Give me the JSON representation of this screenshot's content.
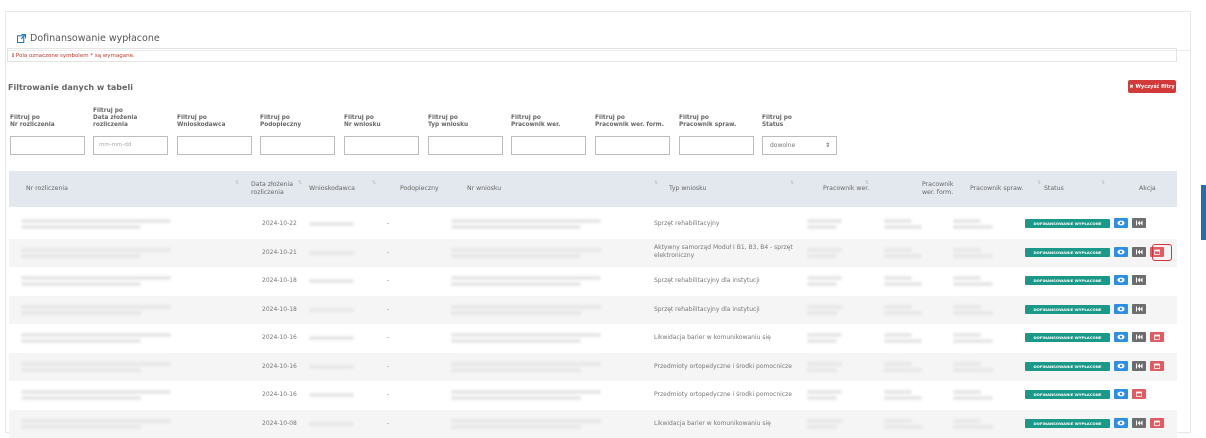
{
  "panel": {
    "title": "Dofinansowanie wypłacone"
  },
  "notice": {
    "text": "ℹ Pola oznaczone symbolem * są wymagane."
  },
  "filters": {
    "title": "Filtrowanie danych w tabeli",
    "clear_label": "Wyczyść filtry",
    "labels": [
      "Filtruj po\nNr rozliczenia",
      "Filtruj po\nData złożenia\nrozliczenia",
      "Filtruj po\nWnioskodawca",
      "Filtruj po\nPodopieczny",
      "Filtruj po\nNr wniosku",
      "Filtruj po\nTyp wniosku",
      "Filtruj po\nPracownik wer.",
      "Filtruj po\nPracownik wer. form.",
      "Filtruj po\nPracownik spraw.",
      "Filtruj po\nStatus"
    ],
    "date_placeholder": "mm-mm-dd",
    "status_value": "dowolne"
  },
  "table": {
    "columns": [
      "Nr rozliczenia",
      "Data złożenia rozliczenia",
      "Wnioskodawca",
      "Podopieczny",
      "Nr wniosku",
      "Typ wniosku",
      "Pracownik wer.",
      "Pracownik wer. form.",
      "Pracownik spraw.",
      "Status",
      "Akcja"
    ],
    "rows": [
      {
        "date": "2024-10-22",
        "podopieczny": "-",
        "typ": "Sprzęt rehabilitacyjny",
        "status": "DOFINANSOWANIE WYPŁACONE",
        "actions": [
          "eye",
          "ff"
        ]
      },
      {
        "date": "2024-10-21",
        "podopieczny": "-",
        "typ": "Aktywny samorząd Moduł I B1, B3, B4 - sprzęt elektroniczny",
        "status": "DOFINANSOWANIE WYPŁACONE",
        "actions": [
          "eye",
          "ff",
          "del"
        ]
      },
      {
        "date": "2024-10-18",
        "podopieczny": "-",
        "typ": "Sprzęt rehabilitacyjny dla instytucji",
        "status": "DOFINANSOWANIE WYPŁACONE",
        "actions": [
          "eye",
          "ff"
        ]
      },
      {
        "date": "2024-10-18",
        "podopieczny": "-",
        "typ": "Sprzęt rehabilitacyjny dla instytucji",
        "status": "DOFINANSOWANIE WYPŁACONE",
        "actions": [
          "eye",
          "ff"
        ]
      },
      {
        "date": "2024-10-16",
        "podopieczny": "-",
        "typ": "Likwidacja barier w komunikowaniu się",
        "status": "DOFINANSOWANIE WYPŁACONE",
        "actions": [
          "eye",
          "ff",
          "del"
        ]
      },
      {
        "date": "2024-10-16",
        "podopieczny": "-",
        "typ": "Przedmioty ortopedyczne i środki pomocnicze",
        "status": "DOFINANSOWANIE WYPŁACONE",
        "actions": [
          "eye",
          "ff",
          "del"
        ]
      },
      {
        "date": "2024-10-16",
        "podopieczny": "-",
        "typ": "Przedmioty ortopedyczne i środki pomocnicze",
        "status": "DOFINANSOWANIE WYPŁACONE",
        "actions": [
          "eye",
          "del"
        ]
      },
      {
        "date": "2024-10-08",
        "podopieczny": "-",
        "typ": "Likwidacja barier w komunikowaniu się",
        "status": "DOFINANSOWANIE WYPŁACONE",
        "actions": [
          "eye",
          "ff",
          "del"
        ]
      }
    ]
  },
  "colors": {
    "status_badge": "#1a9988",
    "eye_button": "#2e8de6",
    "ff_button": "#6d6d6d",
    "delete_button": "#e25b60",
    "clear_button": "#d23a3a"
  },
  "icons": {
    "title": "external-link-icon",
    "eye": "eye-icon",
    "ff": "fast-forward-icon",
    "del": "calendar-delete-icon"
  }
}
